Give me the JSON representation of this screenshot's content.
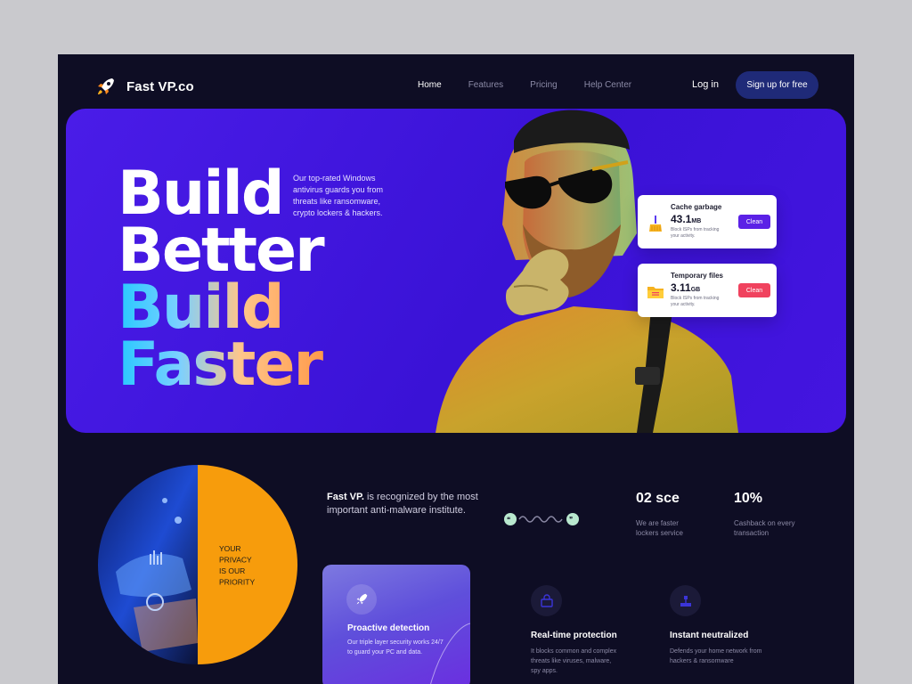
{
  "brand": {
    "name": "Fast VP.co"
  },
  "nav": {
    "items": [
      "Home",
      "Features",
      "Pricing",
      "Help Center"
    ],
    "active": "Home",
    "login": "Log in",
    "signup": "Sign up for free"
  },
  "hero": {
    "headline": [
      "Build",
      "Better",
      "Build",
      "Faster"
    ],
    "description": "Our top-rated Windows antivirus guards you from threats like ransomware, crypto lockers & hackers."
  },
  "cards": [
    {
      "title": "Cache garbage",
      "value": "43.1",
      "unit": "MB",
      "sub": "Block ISPs from tracking your activity.",
      "button": "Clean",
      "button_color": "#5b21e6",
      "icon": "broom-icon"
    },
    {
      "title": "Temporary files",
      "value": "3.11",
      "unit": "GB",
      "sub": "Block ISPs from tracking your activity.",
      "button": "Clean",
      "button_color": "#f0425e",
      "icon": "folder-icon"
    }
  ],
  "privacy": {
    "text": "YOUR PRIVACY IS OUR PRIORITY",
    "color": "#f79c0c"
  },
  "recognition": {
    "bold": "Fast VP.",
    "rest": " is recognized by the most important anti-malware institute."
  },
  "stats": [
    {
      "big": "02 sce",
      "small": "We are faster lockers service"
    },
    {
      "big": "10%",
      "small": "Cashback on every transaction"
    }
  ],
  "features": [
    {
      "title": "Proactive detection",
      "desc": "Our triple layer security works 24/7 to guard your PC and data.",
      "icon": "rocket-icon"
    },
    {
      "title": "Real-time protection",
      "desc": "It blocks common and complex threats like viruses, malware, spy apps.",
      "icon": "shield-lock-icon"
    },
    {
      "title": "Instant neutralized",
      "desc": "Defends your home network from hackers & ransomware",
      "icon": "network-icon"
    }
  ]
}
